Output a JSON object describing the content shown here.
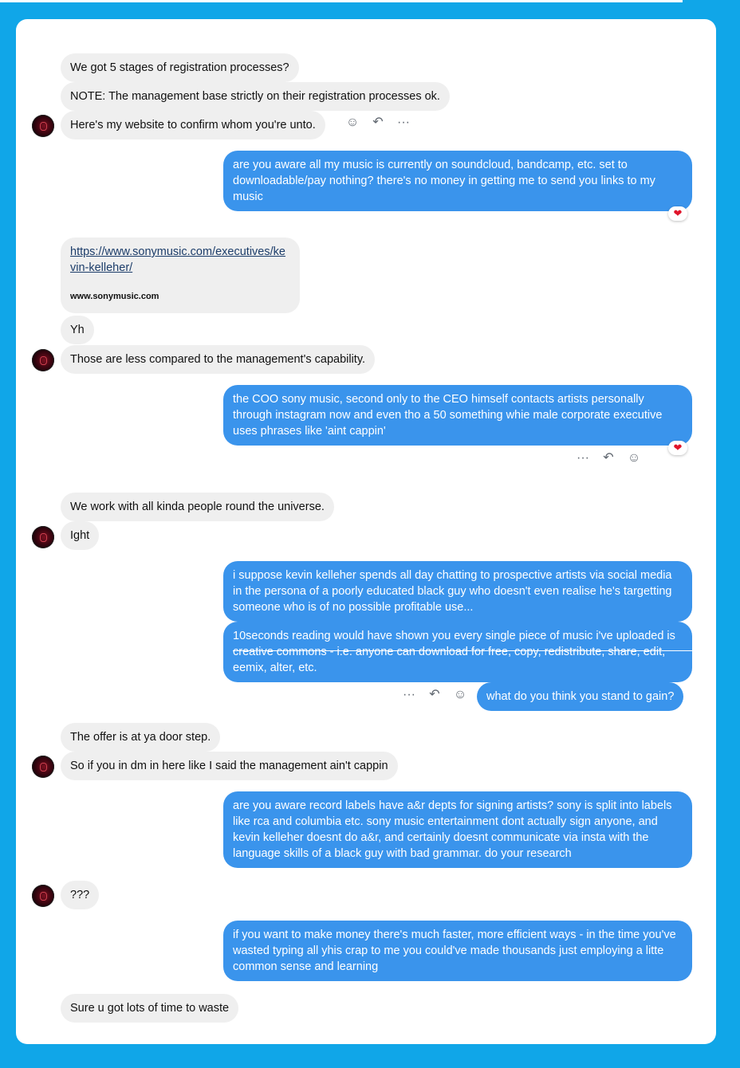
{
  "messages": {
    "m1": "We got 5 stages of registration processes?",
    "m2": "NOTE: The management base strictly on their registration processes ok.",
    "m3": "Here's my website to confirm whom you're unto.",
    "m4": "are you aware all my music is currently on soundcloud, bandcamp, etc. set to downloadable/pay nothing? there's no money in getting me to send you links to my music",
    "link_url": "https://www.sonymusic.com/executives/kevin-kelleher/",
    "link_domain": "www.sonymusic.com",
    "m5": "Yh",
    "m6": "Those are less compared to the management's capability.",
    "m7": "the COO sony music, second only to the CEO himself contacts artists personally through instagram now and even tho a 50 something whie male corporate executive uses phrases like 'aint cappin'",
    "m8": "We work with all kinda people round the universe.",
    "m9": "Ight",
    "m10": "i suppose kevin kelleher spends all day chatting to prospective artists via social media in the persona of a poorly educated black guy who doesn't even realise he's targetting someone who is of no possible profitable use...",
    "m11": "10seconds reading would have shown you every single piece of music i've uploaded is creative commons - i.e. anyone can download for free, copy, redistribute, share, edit, eemix, alter, etc.",
    "m12": "what do you think you stand to gain?",
    "m13": "The offer is at ya door step.",
    "m14": "So if you in dm in here like I said the management ain't cappin",
    "m15": "are you aware record labels have a&r depts for signing artists? sony is split into labels like rca and columbia etc. sony music entertainment dont actually sign anyone, and kevin kelleher doesnt do a&r, and certainly doesnt communicate via insta with the language skills of a black guy with bad grammar. do your research",
    "m16": "???",
    "m17": "if you want to make money there's much faster, more efficient ways - in the time you've wasted typing all yhis crap to me you could've made thousands just employing a litte common sense and learning",
    "m18": "Sure u got lots of time to waste"
  },
  "icons": {
    "react": "☺",
    "reply": "↶",
    "more": "···",
    "heart": "❤"
  },
  "colors": {
    "background": "#10a6e8",
    "outgoing": "#3a94ec",
    "incoming": "#efefef",
    "reaction": "#e0142a"
  }
}
